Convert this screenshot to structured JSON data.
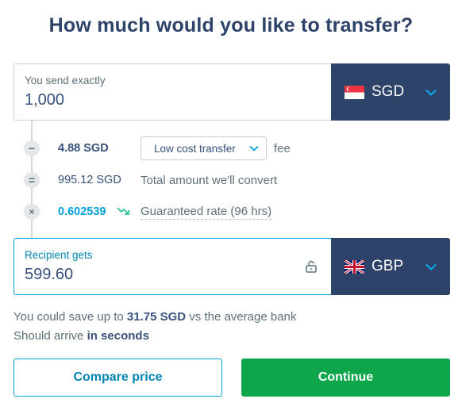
{
  "title": "How much would you like to transfer?",
  "send": {
    "label": "You send exactly",
    "value": "1,000",
    "currency": "SGD",
    "flag": "singapore-flag-icon"
  },
  "fees": {
    "fee_amount": "4.88 SGD",
    "fee_type": "Low cost transfer",
    "fee_suffix": "fee",
    "convert_amount": "995.12 SGD",
    "convert_label": "Total amount we'll convert",
    "rate": "0.602539",
    "rate_label": "Guaranteed rate (96 hrs)",
    "icons": [
      "minus-icon",
      "equals-icon",
      "times-icon",
      "trend-down-icon"
    ]
  },
  "receive": {
    "label": "Recipient gets",
    "value": "599.60",
    "currency": "GBP",
    "flag": "uk-flag-icon"
  },
  "savings": {
    "prefix": "You could save up to ",
    "amount": "31.75 SGD",
    "suffix": " vs the average bank"
  },
  "arrival": {
    "prefix": "Should arrive ",
    "value": "in seconds"
  },
  "buttons": {
    "compare": "Compare price",
    "continue": "Continue"
  },
  "colors": {
    "navy": "#2e4369",
    "accent": "#00a2dd",
    "green": "#0fa54b",
    "rate_trend": "#2ec4a0"
  }
}
